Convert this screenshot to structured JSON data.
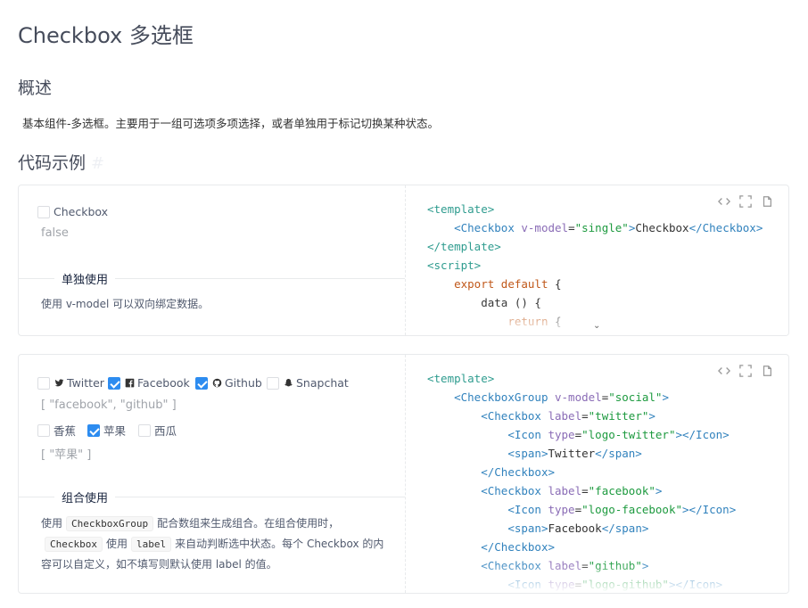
{
  "page": {
    "title": "Checkbox 多选框",
    "overview_heading": "概述",
    "description": "基本组件-多选框。主要用于一组可选项多项选择，或者单独用于标记切换某种状态。",
    "examples_heading": "代码示例",
    "anchor": "#"
  },
  "example1": {
    "checkbox_label": "Checkbox",
    "checked": false,
    "value_text": "false",
    "meta_title": "单独使用",
    "meta_desc": "使用 v-model 可以双向绑定数据。",
    "code_lines": [
      {
        "t": "<template>"
      },
      {
        "t": "<Checkbox v-model=\"single\">Checkbox</Checkbox>"
      },
      {
        "t": "</template>"
      },
      {
        "t": "<script>"
      },
      {
        "t": "export default {"
      },
      {
        "t": "data () {"
      },
      {
        "t": "return {"
      }
    ]
  },
  "example2": {
    "social": [
      {
        "label": "Twitter",
        "icon": "twitter-icon",
        "checked": false
      },
      {
        "label": "Facebook",
        "icon": "facebook-icon",
        "checked": true
      },
      {
        "label": "Github",
        "icon": "github-icon",
        "checked": true
      },
      {
        "label": "Snapchat",
        "icon": "snapchat-icon",
        "checked": false
      }
    ],
    "social_value": "[ \"facebook\", \"github\" ]",
    "fruit": [
      {
        "label": "香蕉",
        "checked": false
      },
      {
        "label": "苹果",
        "checked": true
      },
      {
        "label": "西瓜",
        "checked": false
      }
    ],
    "fruit_value": "[ \"苹果\" ]",
    "meta_title": "组合使用",
    "meta_desc_1": "使用",
    "tag_group": "CheckboxGroup",
    "meta_desc_2": "配合数组来生成组合。在组合使用时，",
    "tag_checkbox": "Checkbox",
    "meta_desc_3": "使用",
    "tag_label": "label",
    "meta_desc_4": "来自动判断选中状态。每个 Checkbox 的内容可以自定义，如不填写则默认使用 label 的值。"
  },
  "colors": {
    "accent": "#2d8cf0",
    "tag_green": "#2f9c8f",
    "attr_purple": "#8a6cb6",
    "string_green": "#1d9a3f",
    "keyword_orange": "#c0581a"
  },
  "toolbar": {
    "icons": [
      "code-icon",
      "fullscreen-icon",
      "copy-icon"
    ]
  }
}
